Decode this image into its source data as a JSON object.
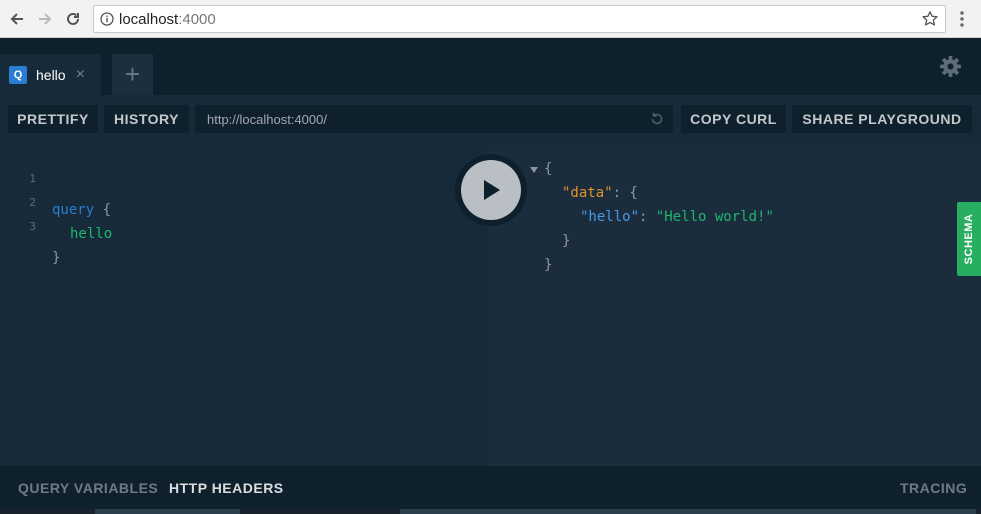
{
  "browser": {
    "url_host": "localhost",
    "url_port": ":4000"
  },
  "tabs": [
    {
      "badge": "Q",
      "label": "hello",
      "close": "×"
    }
  ],
  "tab_add": "+",
  "toolbar": {
    "prettify": "PRETTIFY",
    "history": "HISTORY",
    "endpoint": "http://localhost:4000/",
    "copy_curl": "COPY CURL",
    "share": "SHARE PLAYGROUND"
  },
  "query_editor": {
    "lines": [
      {
        "num": "1",
        "keyword": "query",
        "brace": "{"
      },
      {
        "num": "2",
        "field": "hello"
      },
      {
        "num": "3",
        "brace": "}"
      }
    ]
  },
  "result": {
    "open_brace": "{",
    "data_key": "\"data\"",
    "data_colon": ": {",
    "hello_key": "\"hello\"",
    "hello_colon": ": ",
    "hello_value": "\"Hello world!\"",
    "inner_close": "}",
    "outer_close": "}"
  },
  "schema_tab": "SCHEMA",
  "bottom": {
    "query_variables": "QUERY VARIABLES",
    "http_headers": "HTTP HEADERS",
    "tracing": "TRACING"
  },
  "colors": {
    "accent_blue": "#2a7ed2",
    "schema_green": "#27ae60",
    "field_green": "#1cb66f",
    "data_orange": "#e0922f"
  }
}
